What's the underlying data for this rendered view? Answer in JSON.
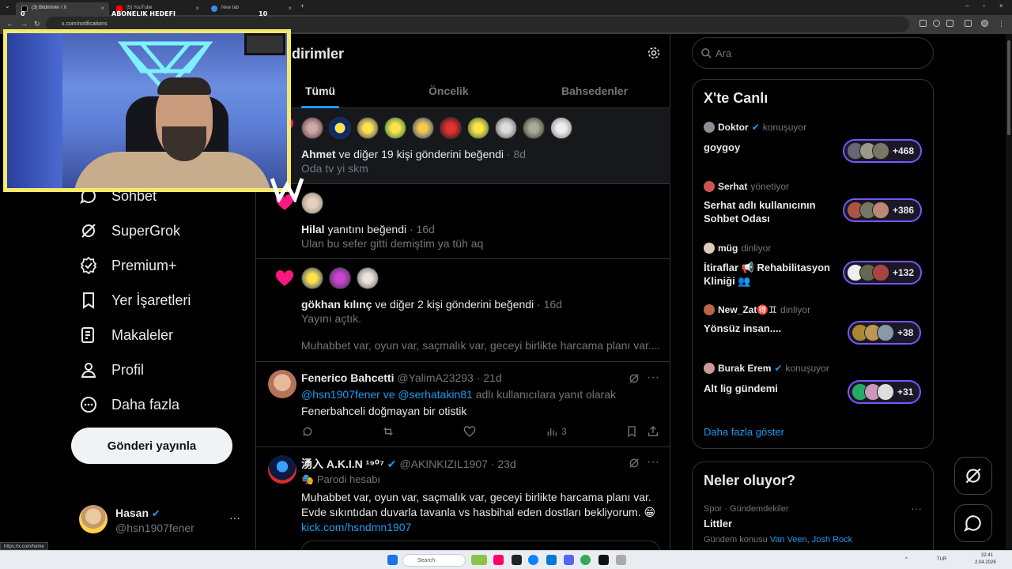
{
  "browser": {
    "tabs": [
      {
        "title": "(3) Bildirimler / X",
        "active": true
      },
      {
        "title": "(5) YouTube",
        "active": false
      },
      {
        "title": "New tab",
        "active": false
      }
    ],
    "url": "x.com/notifications",
    "status_url": "https://x.com/home"
  },
  "stream_overlay": {
    "goal_label": "ABONELIK HEDEFI",
    "goal_current": "0",
    "goal_target": "10"
  },
  "nav": {
    "items": [
      {
        "label": "Sohbet",
        "icon": "chat-icon"
      },
      {
        "label": "SuperGrok",
        "icon": "grok-icon"
      },
      {
        "label": "Premium+",
        "icon": "verified-icon"
      },
      {
        "label": "Yer İşaretleri",
        "icon": "bookmark-icon"
      },
      {
        "label": "Makaleler",
        "icon": "article-icon"
      },
      {
        "label": "Profil",
        "icon": "person-icon"
      },
      {
        "label": "Daha fazla",
        "icon": "more-circle-icon"
      }
    ],
    "post_button": "Gönderi yayınla",
    "account": {
      "name": "Hasan",
      "handle": "@hsn1907fener",
      "more": "···"
    }
  },
  "main": {
    "title": "dirimler",
    "tabs": [
      "Tümü",
      "Öncelik",
      "Bahsedenler"
    ],
    "notifications": [
      {
        "actor": "Ahmet",
        "text": " ve diğer 19 kişi gönderini beğendi",
        "time": " · 8d",
        "preview": "Oda tv yi skm"
      },
      {
        "actor": "Hilal",
        "text": " yanıtını beğendi",
        "time": " · 16d",
        "preview": "Ulan bu sefer gitti demiştim ya tüh aq"
      },
      {
        "actor": "gökhan kılınç",
        "text": " ve diğer 2 kişi gönderini beğendi",
        "time": " · 16d",
        "preview": "Yayını açtık.",
        "preview2": "Muhabbet var, oyun var, saçmalık var, geceyi birlikte harcama planı var...."
      }
    ],
    "tweets": [
      {
        "name": "Fenerico Bahcetti",
        "handle": "@YalimA23293",
        "time": "· 21d",
        "reply_to_1": "@hsn1907fener",
        "reply_and": " ve ",
        "reply_to_2": "@serhatakin81",
        "reply_suffix": " adlı kullanıcılara yanıt olarak",
        "text": "Fenerbahceli doğmayan bir otistik",
        "views": "3"
      },
      {
        "name": "湧入 A.K.I.N ¹⁹⁰⁷",
        "handle": "@AKINKIZIL1907",
        "time": "· 23d",
        "label": "Parodi hesabı",
        "line1": "Muhabbet var, oyun var, saçmalık var, geceyi birlikte harcama planı var.",
        "line2": "Evde sıkıntıdan duvarla tavanla vs hasbihal eden dostları bekliyorum. 😁",
        "link": "kick.com/hsndmn1907"
      }
    ]
  },
  "right": {
    "search_placeholder": "Ara",
    "live_title": "X'te Canlı",
    "spaces": [
      {
        "host": "Doktor",
        "role": "konuşuyor",
        "title": "goygoy",
        "count": "+468"
      },
      {
        "host": "Serhat",
        "role": "yönetiyor",
        "title": "Serhat adlı kullanıcının Sohbet Odası",
        "count": "+386"
      },
      {
        "host": "müg",
        "role": "dinliyor",
        "title": "İtiraflar 📢 Rehabilitasyon Kliniği 👥",
        "count": "+132"
      },
      {
        "host": "New_Zat🉐♊",
        "role": "dinliyor",
        "title": "Yönsüz insan....",
        "count": "+38"
      },
      {
        "host": "Burak Erem",
        "role": "konuşuyor",
        "title": "Alt lig gündemi",
        "count": "+31"
      }
    ],
    "show_more": "Daha fazla göster",
    "trends_title": "Neler oluyor?",
    "trend": {
      "context": "Spor · Gündemdekiler",
      "name": "Littler",
      "related_prefix": "Gündem konusu ",
      "related": "Van Veen, Josh Rock"
    }
  },
  "taskbar": {
    "search": "Search",
    "lang": "TUR",
    "time": "22:41",
    "date": "2.04.2026"
  },
  "colors": {
    "accent": "#1d9bf0",
    "like": "#f91880",
    "border": "#2f3336",
    "space_purple": "#7856ff",
    "cam_border": "#f4ea6a"
  }
}
